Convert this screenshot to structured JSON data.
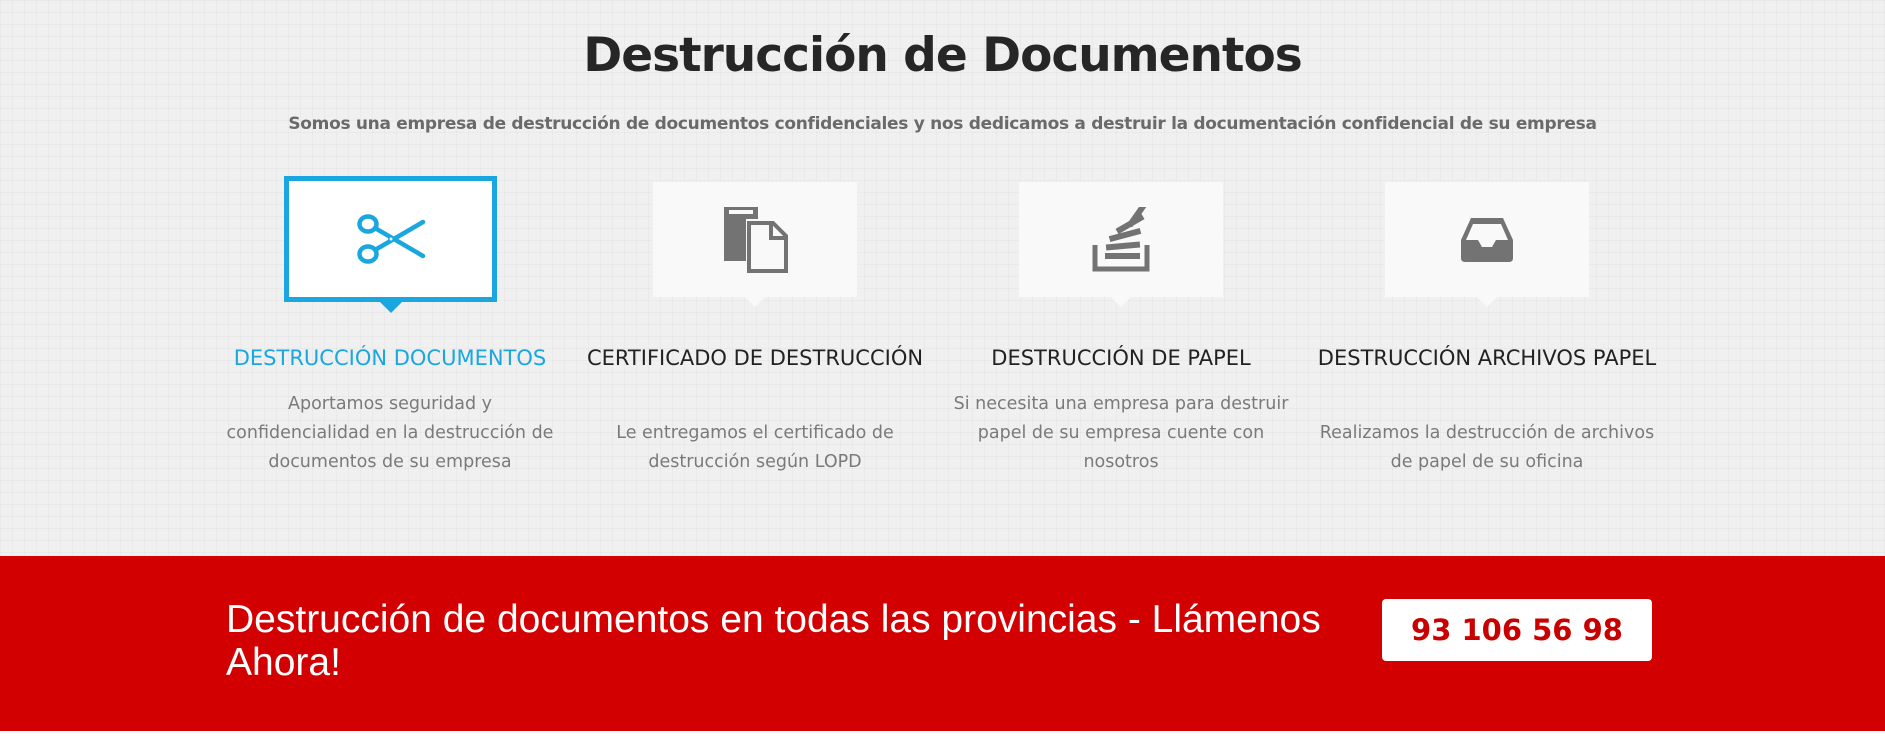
{
  "section": {
    "title": "Destrucción de Documentos",
    "subtitle": "Somos una empresa de destrucción de documentos confidenciales y nos dedicamos a destruir la documentación confidencial de su empresa"
  },
  "services": [
    {
      "icon": "scissors-icon",
      "title": "DESTRUCCIÓN DOCUMENTOS",
      "text": "Aportamos seguridad y confidencialidad en la destrucción de documentos de su empresa",
      "active": true
    },
    {
      "icon": "copy-documents-icon",
      "title": "CERTIFICADO DE DESTRUCCIÓN",
      "text": "Le entregamos el certificado de destrucción según LOPD",
      "active": false
    },
    {
      "icon": "stack-papers-icon",
      "title": "DESTRUCCIÓN DE PAPEL",
      "text": "Si necesita una empresa para destruir papel de su empresa cuente con nosotros",
      "active": false
    },
    {
      "icon": "inbox-tray-icon",
      "title": "DESTRUCCIÓN ARCHIVOS PAPEL",
      "text": "Realizamos la destrucción de archivos de papel de su oficina",
      "active": false
    }
  ],
  "cta": {
    "text": "Destrucción de documentos en todas las provincias - Llámenos Ahora!",
    "phone": "93 106 56 98"
  },
  "colors": {
    "accent_blue": "#1aa7e0",
    "cta_red": "#d20000",
    "icon_gray": "#737373"
  }
}
